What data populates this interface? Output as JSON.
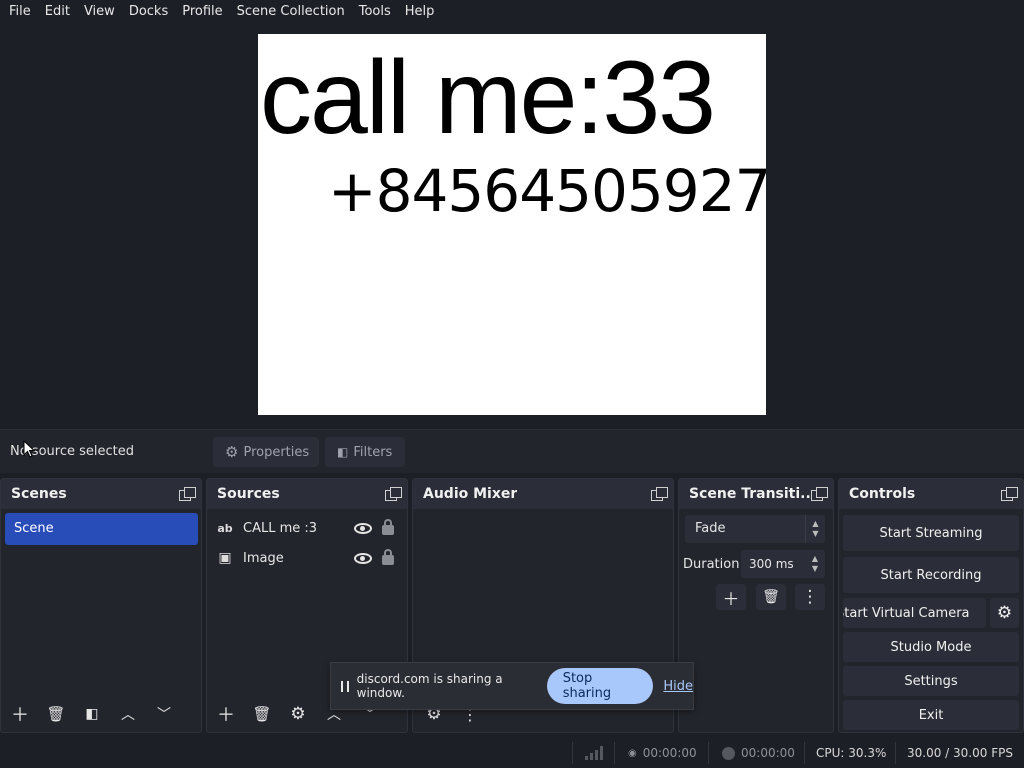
{
  "menu": [
    "File",
    "Edit",
    "View",
    "Docks",
    "Profile",
    "Scene Collection",
    "Tools",
    "Help"
  ],
  "preview": {
    "line1": "call me:33",
    "line2": "+84564505927"
  },
  "source_toolbar": {
    "status": "No source selected",
    "properties_label": "Properties",
    "filters_label": "Filters"
  },
  "docks": {
    "scenes": {
      "title": "Scenes",
      "items": [
        "Scene"
      ]
    },
    "sources": {
      "title": "Sources",
      "items": [
        {
          "label": "CALL me :3",
          "icon": "text-icon",
          "icon_glyph": "ab"
        },
        {
          "label": "Image",
          "icon": "image-icon",
          "icon_glyph": "▣"
        }
      ]
    },
    "audio_mixer": {
      "title": "Audio Mixer"
    },
    "transitions": {
      "title": "Scene Transiti...",
      "selected": "Fade",
      "duration_label": "Duration",
      "duration_value": "300 ms"
    },
    "controls": {
      "title": "Controls",
      "start_streaming": "Start Streaming",
      "start_recording": "Start Recording",
      "start_virtual_camera": "Start Virtual Camera",
      "studio_mode": "Studio Mode",
      "settings": "Settings",
      "exit": "Exit"
    }
  },
  "share_bar": {
    "message": "discord.com is sharing a window.",
    "stop_label": "Stop sharing",
    "hide_label": "Hide"
  },
  "status": {
    "stream_time": "00:00:00",
    "record_time": "00:00:00",
    "cpu": "CPU: 30.3%",
    "fps": "30.00 / 30.00 FPS"
  },
  "colors": {
    "background": "#1d1f26",
    "panel": "#23252d",
    "selected_scene": "#284cb8",
    "share_button": "#a8c7fa"
  }
}
